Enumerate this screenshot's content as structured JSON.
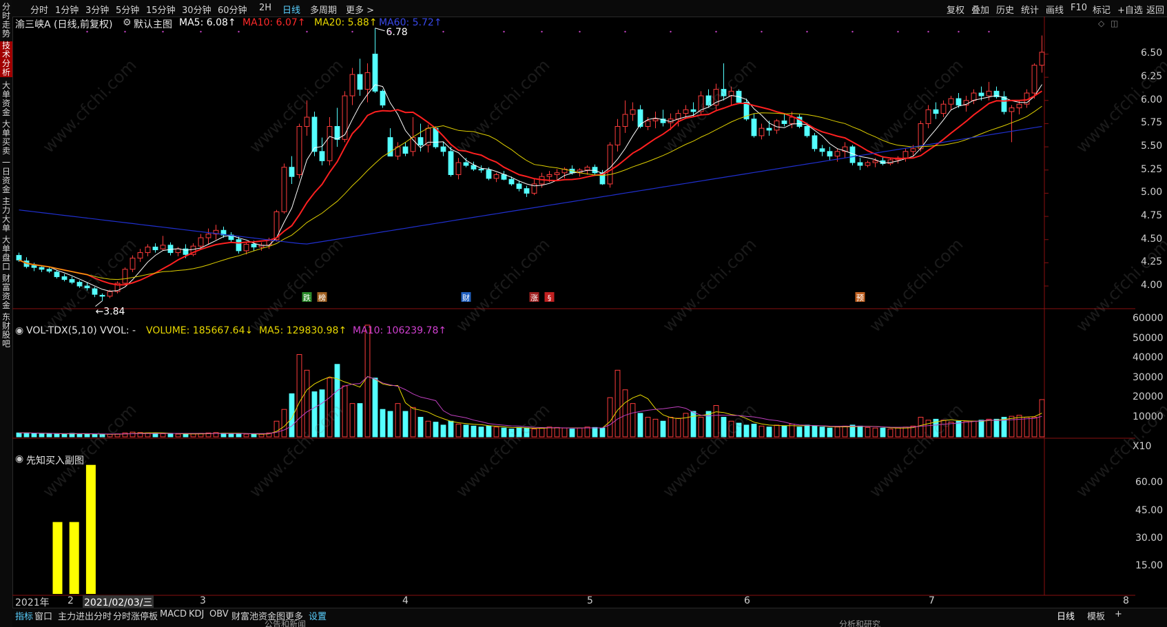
{
  "left_tabs": [
    "分时走势",
    "技术分析",
    "大单资金",
    "大单买卖",
    "一日资金",
    "主力大单",
    "大单盘口",
    "财富资金",
    "东财股吧"
  ],
  "toolbar": {
    "periods": [
      "分时",
      "1分钟",
      "3分钟",
      "5分钟",
      "15分钟",
      "30分钟",
      "60分钟",
      "2H",
      "日线",
      "多周期",
      "更多 >"
    ],
    "active_period": "日线",
    "right": [
      "复权",
      "叠加",
      "历史",
      "统计",
      "画线",
      "F10",
      "标记",
      "+自选",
      "返回"
    ]
  },
  "main_legend": {
    "title": "渝三峡A (日线,前复权)",
    "chart_name": "默认主图",
    "ma5": "MA5: 6.08↑",
    "ma10": "MA10: 6.07↑",
    "ma20": "MA20: 5.88↑",
    "ma60": "MA60: 5.72↑"
  },
  "vol_legend": {
    "name": "VOL-TDX(5,10) VVOL: -",
    "volume": "VOLUME: 185667.64↓",
    "ma5": "MA5: 129830.98↑",
    "ma10": "MA10: 106239.78↑"
  },
  "sub_legend": {
    "name": "先知买入副图"
  },
  "colors": {
    "up": "#ff3c3c",
    "down": "#54ffff",
    "ma5": "#ffffff",
    "ma10": "#ff2020",
    "ma20": "#e0d000",
    "ma60": "#2030d0",
    "bg": "#000000"
  },
  "price_axis": [
    "6.50",
    "6.25",
    "6.00",
    "5.75",
    "5.50",
    "5.25",
    "5.00",
    "4.75",
    "4.50",
    "4.25",
    "4.00"
  ],
  "vol_axis": [
    "60000",
    "50000",
    "40000",
    "30000",
    "20000",
    "10000",
    "X10"
  ],
  "sub_axis": [
    "60.00",
    "45.00",
    "30.00",
    "15.00"
  ],
  "annotations": {
    "high": "6.78",
    "low": "3.84"
  },
  "event_tags": [
    "跌",
    "榜",
    "财",
    "涨",
    "§",
    "预"
  ],
  "date_axis": {
    "year": "2021年",
    "labels": [
      "2",
      "2021/02/03/三",
      "3",
      "4",
      "5",
      "6",
      "7",
      "8"
    ]
  },
  "bottom_tabs": [
    "指标",
    "窗口",
    "主力进出分时",
    "分时涨停板",
    "MACD",
    "KDJ",
    "OBV",
    "财富池资金图",
    "更多",
    "设置"
  ],
  "bottom_right": [
    "日线",
    "模板",
    "+"
  ],
  "footer": [
    "公告和新闻",
    "分析和研究"
  ],
  "watermark": "www.cfchi.com",
  "chart_data": [
    {
      "type": "candlestick",
      "title": "渝三峡A (日线,前复权)",
      "ylim": [
        3.84,
        6.78
      ],
      "x_months": [
        "2",
        "3",
        "4",
        "5",
        "6",
        "7",
        "8"
      ],
      "ohlc": [
        [
          4.33,
          4.36,
          4.26,
          4.28
        ],
        [
          4.27,
          4.31,
          4.19,
          4.21
        ],
        [
          4.22,
          4.25,
          4.16,
          4.2
        ],
        [
          4.2,
          4.22,
          4.15,
          4.18
        ],
        [
          4.18,
          4.21,
          4.14,
          4.16
        ],
        [
          4.15,
          4.17,
          4.08,
          4.1
        ],
        [
          4.1,
          4.13,
          4.05,
          4.07
        ],
        [
          4.07,
          4.1,
          4.02,
          4.04
        ],
        [
          4.04,
          4.06,
          3.98,
          4.0
        ],
        [
          4.0,
          4.04,
          3.95,
          3.98
        ],
        [
          3.97,
          3.99,
          3.88,
          3.91
        ],
        [
          3.9,
          3.92,
          3.84,
          3.89
        ],
        [
          3.89,
          3.96,
          3.87,
          3.94
        ],
        [
          3.94,
          4.05,
          3.92,
          4.03
        ],
        [
          4.03,
          4.2,
          4.01,
          4.18
        ],
        [
          4.18,
          4.33,
          4.15,
          4.3
        ],
        [
          4.3,
          4.4,
          4.26,
          4.36
        ],
        [
          4.36,
          4.45,
          4.32,
          4.42
        ],
        [
          4.42,
          4.46,
          4.36,
          4.39
        ],
        [
          4.4,
          4.54,
          4.38,
          4.44
        ],
        [
          4.44,
          4.47,
          4.33,
          4.36
        ],
        [
          4.36,
          4.42,
          4.32,
          4.4
        ],
        [
          4.4,
          4.45,
          4.3,
          4.34
        ],
        [
          4.34,
          4.46,
          4.32,
          4.43
        ],
        [
          4.43,
          4.56,
          4.4,
          4.52
        ],
        [
          4.52,
          4.62,
          4.45,
          4.56
        ],
        [
          4.56,
          4.66,
          4.5,
          4.6
        ],
        [
          4.6,
          4.64,
          4.52,
          4.55
        ],
        [
          4.55,
          4.58,
          4.47,
          4.5
        ],
        [
          4.5,
          4.53,
          4.35,
          4.38
        ],
        [
          4.38,
          4.48,
          4.34,
          4.45
        ],
        [
          4.45,
          4.49,
          4.38,
          4.42
        ],
        [
          4.42,
          4.47,
          4.38,
          4.44
        ],
        [
          4.44,
          4.52,
          4.4,
          4.5
        ],
        [
          4.5,
          4.82,
          4.48,
          4.8
        ],
        [
          4.8,
          5.32,
          4.78,
          5.28
        ],
        [
          5.28,
          5.4,
          5.1,
          5.18
        ],
        [
          5.2,
          5.75,
          5.16,
          5.72
        ],
        [
          5.72,
          6.0,
          5.62,
          5.82
        ],
        [
          5.82,
          5.88,
          5.4,
          5.45
        ],
        [
          5.45,
          5.6,
          5.3,
          5.35
        ],
        [
          5.35,
          5.82,
          5.3,
          5.72
        ],
        [
          5.72,
          5.92,
          5.5,
          5.58
        ],
        [
          5.58,
          6.1,
          5.55,
          6.05
        ],
        [
          6.05,
          6.35,
          5.95,
          6.28
        ],
        [
          6.28,
          6.45,
          6.05,
          6.12
        ],
        [
          6.12,
          6.4,
          5.98,
          6.3
        ],
        [
          6.5,
          6.78,
          6.08,
          6.1
        ],
        [
          6.1,
          6.12,
          5.92,
          5.95
        ],
        [
          5.6,
          5.7,
          5.4,
          5.4
        ],
        [
          5.4,
          5.55,
          5.36,
          5.5
        ],
        [
          5.5,
          5.55,
          5.4,
          5.43
        ],
        [
          5.45,
          5.82,
          5.4,
          5.6
        ],
        [
          5.6,
          5.75,
          5.45,
          5.52
        ],
        [
          5.52,
          5.74,
          5.44,
          5.7
        ],
        [
          5.7,
          5.72,
          5.48,
          5.5
        ],
        [
          5.5,
          5.55,
          5.4,
          5.45
        ],
        [
          5.45,
          5.5,
          5.18,
          5.2
        ],
        [
          5.2,
          5.38,
          5.15,
          5.33
        ],
        [
          5.33,
          5.38,
          5.28,
          5.3
        ],
        [
          5.3,
          5.34,
          5.24,
          5.26
        ],
        [
          5.26,
          5.3,
          5.22,
          5.25
        ],
        [
          5.25,
          5.28,
          5.14,
          5.16
        ],
        [
          5.16,
          5.22,
          5.12,
          5.2
        ],
        [
          5.2,
          5.24,
          5.14,
          5.15
        ],
        [
          5.15,
          5.18,
          5.08,
          5.1
        ],
        [
          5.1,
          5.13,
          5.02,
          5.05
        ],
        [
          5.05,
          5.08,
          4.96,
          5.0
        ],
        [
          5.0,
          5.15,
          4.98,
          5.1
        ],
        [
          5.1,
          5.22,
          5.06,
          5.18
        ],
        [
          5.18,
          5.24,
          5.12,
          5.2
        ],
        [
          5.2,
          5.26,
          5.14,
          5.22
        ],
        [
          5.22,
          5.28,
          5.16,
          5.26
        ],
        [
          5.26,
          5.3,
          5.2,
          5.22
        ],
        [
          5.22,
          5.27,
          5.18,
          5.25
        ],
        [
          5.25,
          5.3,
          5.2,
          5.28
        ],
        [
          5.28,
          5.31,
          5.2,
          5.22
        ],
        [
          5.22,
          5.25,
          5.09,
          5.1
        ],
        [
          5.1,
          5.55,
          5.06,
          5.52
        ],
        [
          5.52,
          5.8,
          5.45,
          5.72
        ],
        [
          5.72,
          6.0,
          5.65,
          5.85
        ],
        [
          5.85,
          5.98,
          5.78,
          5.9
        ],
        [
          5.9,
          5.95,
          5.7,
          5.72
        ],
        [
          5.72,
          5.82,
          5.68,
          5.78
        ],
        [
          5.78,
          5.88,
          5.7,
          5.8
        ],
        [
          5.8,
          5.9,
          5.72,
          5.76
        ],
        [
          5.76,
          5.86,
          5.68,
          5.8
        ],
        [
          5.8,
          5.9,
          5.72,
          5.86
        ],
        [
          5.86,
          5.95,
          5.8,
          5.9
        ],
        [
          5.9,
          5.98,
          5.82,
          5.88
        ],
        [
          5.88,
          6.1,
          5.85,
          6.05
        ],
        [
          6.05,
          6.12,
          5.92,
          5.95
        ],
        [
          5.95,
          6.18,
          5.9,
          6.12
        ],
        [
          6.12,
          6.4,
          6.0,
          6.05
        ],
        [
          6.05,
          6.15,
          5.95,
          6.1
        ],
        [
          6.1,
          6.12,
          5.96,
          5.98
        ],
        [
          5.98,
          6.02,
          5.78,
          5.8
        ],
        [
          5.8,
          5.86,
          5.6,
          5.62
        ],
        [
          5.62,
          5.75,
          5.58,
          5.7
        ],
        [
          5.7,
          5.78,
          5.62,
          5.68
        ],
        [
          5.68,
          5.8,
          5.64,
          5.78
        ],
        [
          5.78,
          5.85,
          5.72,
          5.75
        ],
        [
          5.75,
          5.88,
          5.7,
          5.82
        ],
        [
          5.82,
          5.85,
          5.7,
          5.72
        ],
        [
          5.72,
          5.76,
          5.6,
          5.62
        ],
        [
          5.62,
          5.65,
          5.45,
          5.48
        ],
        [
          5.48,
          5.52,
          5.4,
          5.45
        ],
        [
          5.45,
          5.5,
          5.35,
          5.4
        ],
        [
          5.4,
          5.48,
          5.34,
          5.45
        ],
        [
          5.45,
          5.55,
          5.38,
          5.5
        ],
        [
          5.5,
          5.52,
          5.3,
          5.33
        ],
        [
          5.33,
          5.38,
          5.25,
          5.3
        ],
        [
          5.3,
          5.35,
          5.28,
          5.33
        ],
        [
          5.33,
          5.38,
          5.28,
          5.35
        ],
        [
          5.35,
          5.4,
          5.3,
          5.32
        ],
        [
          5.32,
          5.38,
          5.3,
          5.36
        ],
        [
          5.36,
          5.4,
          5.32,
          5.38
        ],
        [
          5.38,
          5.48,
          5.34,
          5.45
        ],
        [
          5.45,
          5.52,
          5.4,
          5.48
        ],
        [
          5.48,
          5.78,
          5.45,
          5.75
        ],
        [
          5.75,
          5.95,
          5.7,
          5.9
        ],
        [
          5.9,
          5.98,
          5.8,
          5.86
        ],
        [
          5.86,
          6.0,
          5.82,
          5.96
        ],
        [
          5.96,
          6.05,
          5.9,
          6.02
        ],
        [
          6.02,
          6.08,
          5.92,
          5.95
        ],
        [
          5.95,
          6.05,
          5.88,
          6.0
        ],
        [
          6.0,
          6.12,
          5.96,
          6.08
        ],
        [
          6.08,
          6.15,
          6.0,
          6.05
        ],
        [
          6.05,
          6.2,
          6.0,
          6.1
        ],
        [
          6.1,
          6.15,
          6.02,
          6.04
        ],
        [
          6.04,
          6.1,
          5.85,
          5.88
        ],
        [
          5.88,
          5.95,
          5.55,
          5.92
        ],
        [
          5.92,
          6.0,
          5.85,
          5.96
        ],
        [
          5.96,
          6.12,
          5.92,
          6.08
        ],
        [
          6.08,
          6.4,
          6.02,
          6.38
        ],
        [
          6.38,
          6.7,
          6.3,
          6.52
        ]
      ],
      "ma5_last": 6.08,
      "ma10_last": 6.07,
      "ma20_last": 5.88,
      "ma60_last": 5.72,
      "ma60_start": 4.82
    },
    {
      "type": "bar",
      "title": "VOL-TDX(5,10)",
      "ylim": [
        0,
        60000
      ],
      "unit": "X10",
      "values": [
        2,
        2,
        1.8,
        1.5,
        1.6,
        1.4,
        1.5,
        1.8,
        1.6,
        1.4,
        1.2,
        1.2,
        1.3,
        1.5,
        2.0,
        2.4,
        2.2,
        2.0,
        1.8,
        1.6,
        1.5,
        1.4,
        1.3,
        1.5,
        1.8,
        2.0,
        2.2,
        1.8,
        1.6,
        1.5,
        1.4,
        1.3,
        1.3,
        2.0,
        8.0,
        14.0,
        22.0,
        42.0,
        34.0,
        23.0,
        24.0,
        30.0,
        37.0,
        26.0,
        17.0,
        17.0,
        57.0,
        30.0,
        14.0,
        13.0,
        17.0,
        13.0,
        15.0,
        10.0,
        8.0,
        7.5,
        6.0,
        8.0,
        6.5,
        6.0,
        5.5,
        5.0,
        5.5,
        5.0,
        4.5,
        4.0,
        4.8,
        4.5,
        4.0,
        4.5,
        5.0,
        4.8,
        4.5,
        4.0,
        4.5,
        5.0,
        4.8,
        4.5,
        20.0,
        34.0,
        24.0,
        17.0,
        12.0,
        10.0,
        9.0,
        8.0,
        10.0,
        9.5,
        12.0,
        13.0,
        10.0,
        13.0,
        16.0,
        10.0,
        8.0,
        7.0,
        6.0,
        6.5,
        5.5,
        5.0,
        6.0,
        5.5,
        6.5,
        5.0,
        6.0,
        5.5,
        5.0,
        4.5,
        5.0,
        5.5,
        6.0,
        5.5,
        4.8,
        4.5,
        4.5,
        4.0,
        4.5,
        5.0,
        5.5,
        10.0,
        8.5,
        9.0,
        8.5,
        7.5,
        8.0,
        8.0,
        8.0,
        8.5,
        9.0,
        9.0,
        10.0,
        10.5,
        11.0,
        10.0,
        10.0,
        19.0,
        18.5
      ],
      "ma5_last": 129830.98,
      "ma10_last": 106239.78,
      "volume_last": 185667.64
    },
    {
      "type": "bar",
      "title": "先知买入副图",
      "ylim": [
        0,
        75
      ],
      "values": [
        39,
        39,
        70
      ]
    }
  ]
}
